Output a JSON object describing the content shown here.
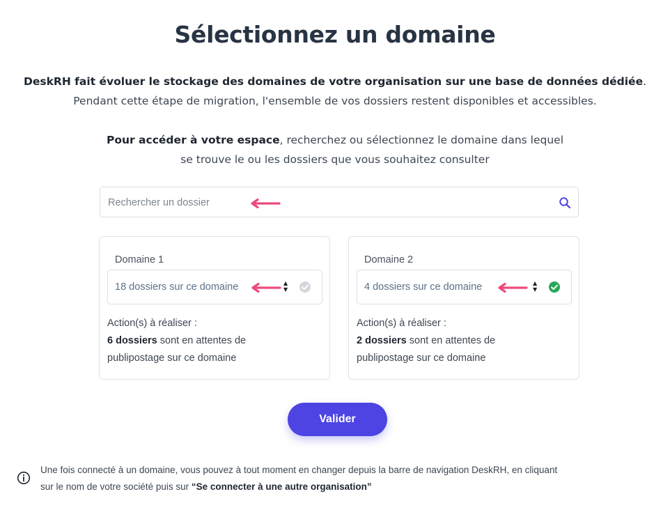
{
  "header": {
    "title": "Sélectionnez un domaine"
  },
  "intro": {
    "line1_bold": "DeskRH fait évoluer le stockage des domaines de votre organisation sur une base de données dédiée",
    "line1_end": ".",
    "line2": "Pendant cette étape de migration, l'ensemble de vos dossiers restent disponibles et accessibles."
  },
  "access": {
    "bold": "Pour accéder à votre espace",
    "rest": ", recherchez ou sélectionnez le domaine dans lequel",
    "line2": "se trouve le ou les dossiers que vous souhaitez consulter"
  },
  "search": {
    "placeholder": "Rechercher un dossier",
    "icon": "search-icon"
  },
  "domains": [
    {
      "label": "Domaine 1",
      "selected_value": "18 dossiers sur ce domaine",
      "status": "unselected",
      "status_color": "#d3d6db",
      "actions_title": "Action(s) à réaliser :",
      "actions_count": "6 dossiers",
      "actions_text1": " sont en attentes de",
      "actions_text2": "publipostage sur ce domaine"
    },
    {
      "label": "Domaine 2",
      "selected_value": "4 dossiers sur ce domaine",
      "status": "selected",
      "status_color": "#2aa65a",
      "actions_title": "Action(s) à réaliser :",
      "actions_count": "2 dossiers",
      "actions_text1": " sont en attentes de",
      "actions_text2": "publipostage sur ce domaine"
    }
  ],
  "submit": {
    "label": "Valider",
    "color": "#4d44e3"
  },
  "note": {
    "icon": "info-icon",
    "text1": "Une fois connecté à un domaine, vous pouvez à tout moment en changer depuis la barre de navigation DeskRH, en cliquant",
    "text2": "sur le nom de votre société puis sur ",
    "link_bold": "“Se connecter à une autre organisation”"
  },
  "annotations": {
    "arrow_color": "#ec4a7a"
  }
}
